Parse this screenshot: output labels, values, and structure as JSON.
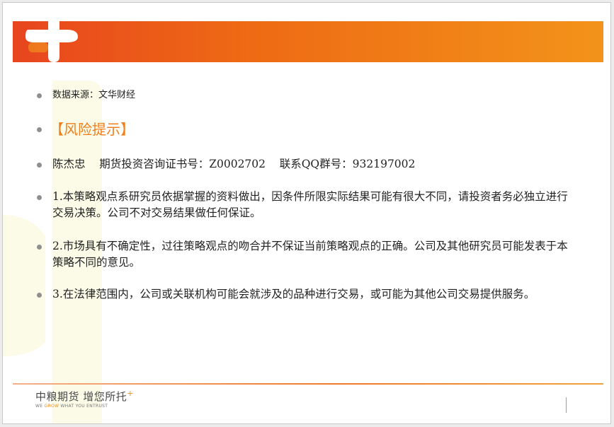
{
  "slide": {
    "source_line": "数据来源：文华财经",
    "risk_title": "【风险提示】",
    "contact_line": "陈杰忠    期货投资咨询证书号：Z0002702    联系QQ群号：932197002",
    "disclaimers": [
      "1.本策略观点系研究员依据掌握的资料做出，因条件所限实际结果可能有很大不同，请投资者务必独立进行交易决策。公司不对交易结果做任何保证。",
      "2.市场具有不确定性，过往策略观点的吻合并不保证当前策略观点的正确。公司及其他研究员可能发表于本策略不同的意见。",
      "3.在法律范围内，公司或关联机构可能会就涉及的品种进行交易，或可能为其他公司交易提供服务。"
    ]
  },
  "footer": {
    "brand_cn": "中粮期货 增您所托",
    "brand_plus": "+",
    "brand_en_prefix": "WE ",
    "brand_en_accent": "GROW",
    "brand_en_suffix": " WHAT YOU ENTRUST"
  },
  "colors": {
    "header_start": "#e8451f",
    "header_end": "#f3931a",
    "risk_title": "#f07f1e",
    "bullet": "#8f8f8f"
  },
  "icons": {
    "logo": "plus-cross-logo",
    "footer_plus": "plus-icon"
  }
}
